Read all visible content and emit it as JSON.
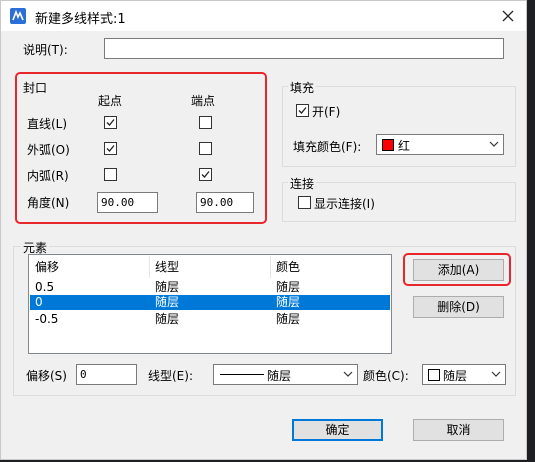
{
  "window": {
    "title": "新建多线样式:1"
  },
  "description": {
    "label": "说明(T):",
    "value": ""
  },
  "caps": {
    "title": "封口",
    "start_header": "起点",
    "end_header": "端点",
    "line_label": "直线(L)",
    "outer_arc_label": "外弧(O)",
    "inner_arc_label": "内弧(R)",
    "angle_label": "角度(N)",
    "line_start": true,
    "line_end": false,
    "outer_start": true,
    "outer_end": false,
    "inner_start": false,
    "inner_end": true,
    "angle_start": "90.00",
    "angle_end": "90.00"
  },
  "fill": {
    "title": "填充",
    "on_label": "开(F)",
    "on_checked": true,
    "color_label": "填充颜色(F):",
    "color_value": "红",
    "color_swatch": "#ff0000"
  },
  "display": {
    "title": "连接",
    "joints_label": "显示连接(I)",
    "joints_checked": false
  },
  "elements": {
    "title": "元素",
    "columns": [
      "偏移",
      "线型",
      "颜色"
    ],
    "rows": [
      {
        "offset": "0.5",
        "linetype": "随层",
        "color": "随层"
      },
      {
        "offset": "0",
        "linetype": "随层",
        "color": "随层"
      },
      {
        "offset": "-0.5",
        "linetype": "随层",
        "color": "随层"
      }
    ],
    "selected_index": 1,
    "add_label": "添加(A)",
    "delete_label": "删除(D)",
    "offset_label": "偏移(S)",
    "offset_value": "0",
    "linetype_label": "线型(E):",
    "linetype_value": "随层",
    "color_label": "颜色(C):",
    "color_value": "随层"
  },
  "buttons": {
    "ok_label": "确定",
    "cancel_label": "取消"
  },
  "colors": {
    "highlight": "#e8262b",
    "selection": "#0078d7"
  }
}
